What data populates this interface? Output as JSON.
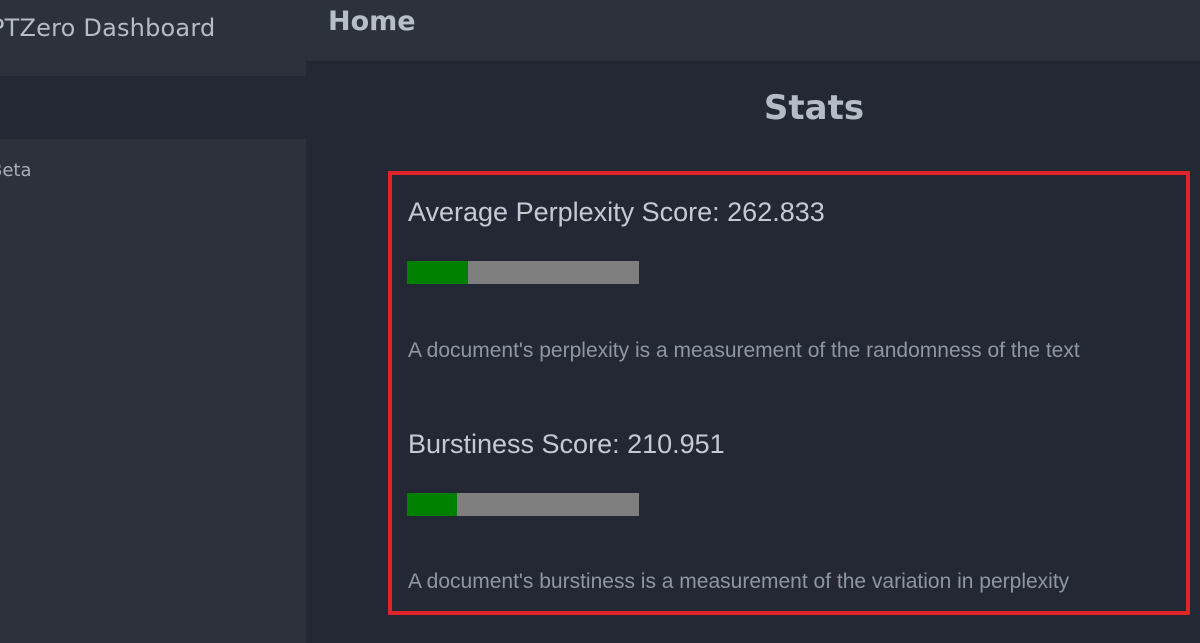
{
  "sidebar": {
    "title": "PTZero Dashboard",
    "items": [
      {
        "label": "Beta"
      }
    ]
  },
  "header": {
    "title": "Home"
  },
  "main": {
    "heading": "Stats",
    "metrics": [
      {
        "title": "Average Perplexity Score: 262.833",
        "progress": 0.265,
        "description": "A document's perplexity is a measurement of the randomness of the text"
      },
      {
        "title": "Burstiness Score: 210.951",
        "progress": 0.215,
        "description": "A document's burstiness is a measurement of the variation in perplexity"
      }
    ]
  },
  "colors": {
    "highlight_border": "#e0242c",
    "progress_fill": "#008000",
    "progress_track": "#7f7f7f"
  }
}
